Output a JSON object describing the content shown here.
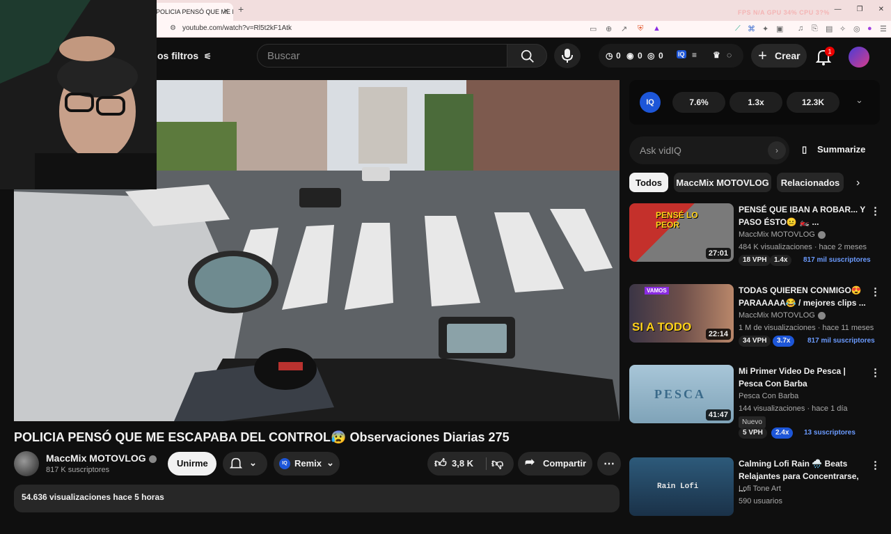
{
  "browser": {
    "tab_title": "POLICIA PENSÓ QUE ME E",
    "url": "youtube.com/watch?v=Rl5t2kF1Atk",
    "perf": "FPS N/A  GPU 34%  CPU 3?%"
  },
  "header": {
    "filters_label": "os filtros",
    "search_placeholder": "Buscar",
    "ext_counts": [
      "0",
      "0",
      "0"
    ],
    "create_label": "Crear",
    "notification_count": "1"
  },
  "video": {
    "title": "POLICIA PENSÓ QUE ME ESCAPABA DEL CONTROL😰 Observaciones Diarias 275",
    "channel": "MaccMix MOTOVLOG",
    "subscribers": "817 K suscriptores",
    "join_label": "Unirme",
    "remix_label": "Remix",
    "likes": "3,8 K",
    "share_label": "Compartir",
    "description_header": "54.636 visualizaciones  hace 5 horas"
  },
  "vidiq": {
    "logo": "IQ",
    "stats": [
      "7.6%",
      "1.3x",
      "12.3K"
    ],
    "ask_placeholder": "Ask vidIQ",
    "summarize_label": "Summarize"
  },
  "chips": [
    "Todos",
    "MaccMix MOTOVLOG",
    "Relacionados"
  ],
  "recommendations": [
    {
      "title": "PENSÉ QUE IBAN A ROBAR... Y PASO ÉSTO😐 🏍️ ...",
      "channel": "MaccMix MOTOVLOG",
      "meta": "484 K visualizaciones · hace 2 meses",
      "duration": "27:01",
      "thumb_text": "PENSÉ LO PEOR",
      "vph": "18 VPH",
      "mult": "1.4x",
      "subs": "817 mil suscriptores"
    },
    {
      "title": "TODAS QUIEREN CONMIGO😍 PARAAAAA😂 / mejores clips ...",
      "channel": "MaccMix MOTOVLOG",
      "meta": "1 M de visualizaciones · hace 11 meses",
      "duration": "22:14",
      "thumb_text": "SI A TODO",
      "thumb_text2": "VAMOS",
      "vph": "34 VPH",
      "mult": "3.7x",
      "subs": "817 mil suscriptores"
    },
    {
      "title": "Mi Primer Video De Pesca | Pesca Con Barba",
      "channel": "Pesca Con Barba",
      "meta": "144 visualizaciones · hace 1 día",
      "duration": "41:47",
      "thumb_text": "PESCA",
      "badge": "Nuevo",
      "vph": "5 VPH",
      "mult": "2.4x",
      "subs": "13 suscriptores"
    },
    {
      "title": "Calming Lofi Rain 🌧️ Beats Relajantes para Concentrarse, ...",
      "channel": "Lofi Tone Art",
      "meta": "590 usuarios",
      "thumb_text": "Rain Lofi"
    }
  ]
}
